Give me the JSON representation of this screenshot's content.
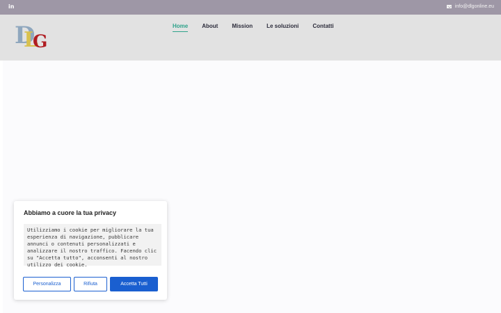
{
  "topbar": {
    "social_icon": "in",
    "email": "info@dlgonline.eu"
  },
  "logo": {
    "d": "D",
    "l": "L",
    "g": "G"
  },
  "nav": {
    "items": [
      {
        "label": "Home",
        "active": true
      },
      {
        "label": "About"
      },
      {
        "label": "Mission"
      },
      {
        "label": "Le soluzioni"
      },
      {
        "label": "Contatti"
      }
    ]
  },
  "cookie": {
    "title": "Abbiamo a cuore la tua privacy",
    "message": "Utilizziamo i cookie per migliorare la tua esperienza di navigazione, pubblicare annunci o contenuti personalizzati e analizzare il nostro traffico. Facendo clic su \"Accetta tutto\", acconsenti al nostro utilizzo dei cookie.",
    "customize_label": "Personalizza",
    "reject_label": "Rifiuta",
    "accept_label": "Accetta Tutti"
  },
  "colors": {
    "topbar_bg": "#9e97a6",
    "header_bg": "#e2e2e2",
    "nav_active": "#2ea28a",
    "button_primary": "#1a5fd0"
  }
}
